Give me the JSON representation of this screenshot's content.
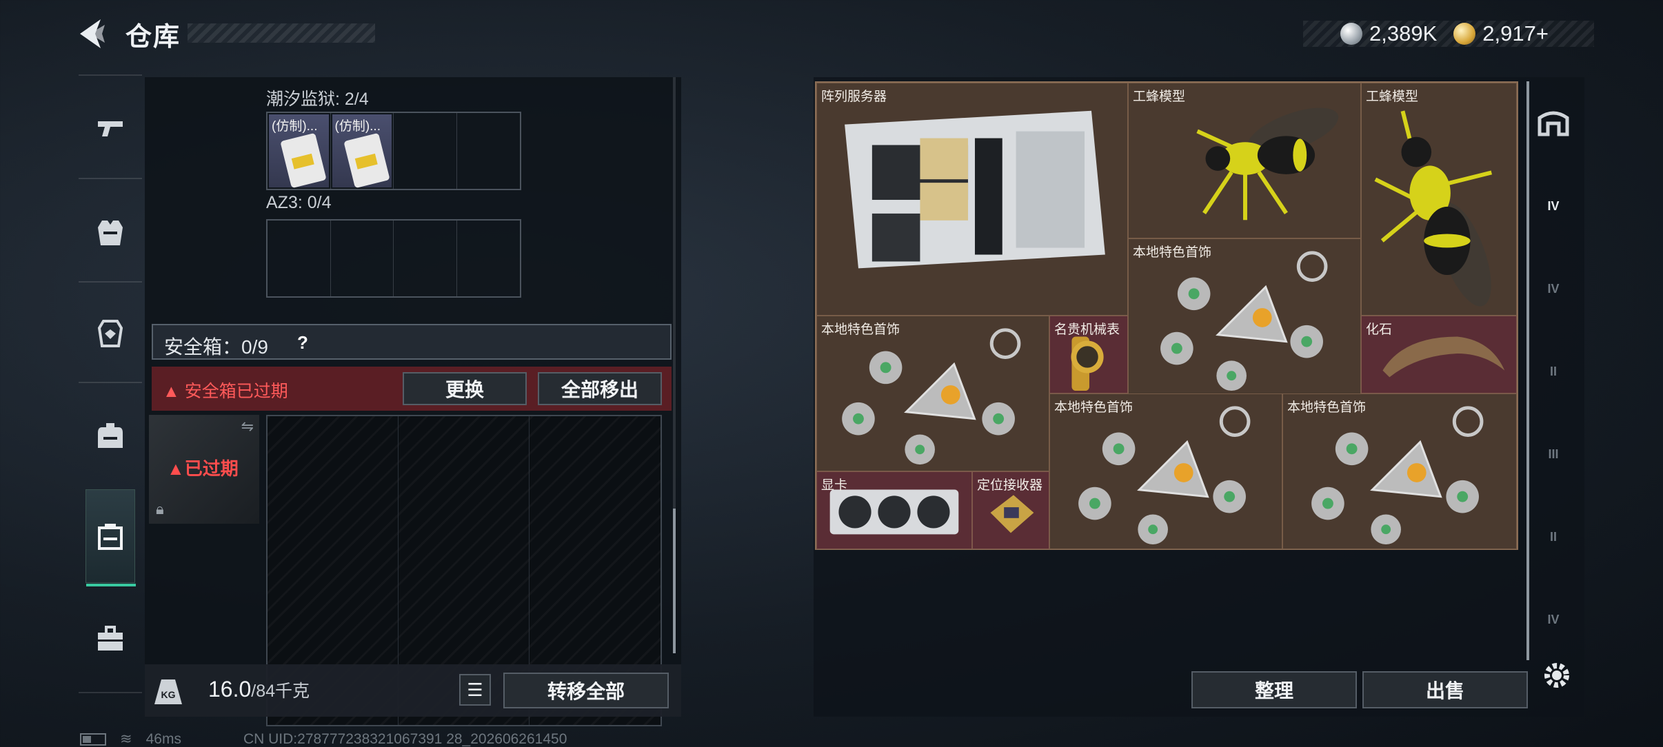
{
  "header": {
    "title": "仓库",
    "back_icon": "chevron-left-icon"
  },
  "currency": {
    "silver": "2,389K",
    "gold": "2,917+"
  },
  "left_nav": [
    {
      "name": "weapon",
      "icon": "gun-icon"
    },
    {
      "name": "armor",
      "icon": "vest-icon"
    },
    {
      "name": "chest-rig",
      "icon": "rig-icon"
    },
    {
      "name": "backpack",
      "icon": "backpack-icon"
    },
    {
      "name": "safe-box",
      "icon": "safe-box-icon",
      "active": true
    },
    {
      "name": "toolbox",
      "icon": "toolbox-icon"
    }
  ],
  "containers": {
    "tide_prison": {
      "label": "潮汐监狱: 2/4",
      "items": [
        "(仿制)...",
        "(仿制)..."
      ]
    },
    "az3": {
      "label": "AZ3: 0/4"
    }
  },
  "safe_box": {
    "title": "安全箱：0/9",
    "help": "?",
    "expired_text": "安全箱已过期",
    "replace_label": "更换",
    "remove_all_label": "全部移出",
    "thumb_label": "已过期"
  },
  "bottom": {
    "weight_icon": "KG",
    "weight": "16.0",
    "weight_max": "/84千克",
    "transfer_all_label": "转移全部"
  },
  "stash": {
    "items": [
      {
        "name": "阵列服务器",
        "color": "brown"
      },
      {
        "name": "工蜂模型",
        "color": "brown"
      },
      {
        "name": "工蜂模型",
        "color": "brown"
      },
      {
        "name": "本地特色首饰",
        "color": "brown"
      },
      {
        "name": "本地特色首饰",
        "color": "brown"
      },
      {
        "name": "名贵机械表",
        "color": "red"
      },
      {
        "name": "化石",
        "color": "red"
      },
      {
        "name": "本地特色首饰",
        "color": "brown"
      },
      {
        "name": "本地特色首饰",
        "color": "brown"
      },
      {
        "name": "显卡",
        "color": "red"
      },
      {
        "name": "定位接收器",
        "color": "red"
      }
    ],
    "sort_label": "整理",
    "sell_label": "出售"
  },
  "right_sidebar": [
    {
      "icon": "home-icon",
      "text": ""
    },
    {
      "icon": "tier-4-safe-icon",
      "text": "IV"
    },
    {
      "icon": "tier-4-box-icon",
      "text": "IV"
    },
    {
      "icon": "tier-2-medkit-icon",
      "text": "II"
    },
    {
      "icon": "tier-3-box-icon",
      "text": "III"
    },
    {
      "icon": "tier-2-tool-icon",
      "text": "II"
    },
    {
      "icon": "tier-4-case-icon",
      "text": "IV"
    }
  ],
  "status": {
    "ping": "46ms",
    "uid": "CN UID:278777238321067391 28_202606261450"
  }
}
